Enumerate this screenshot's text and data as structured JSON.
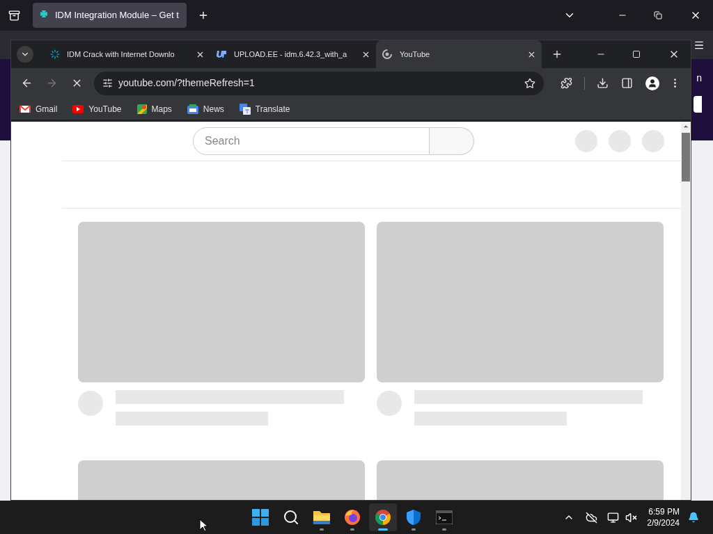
{
  "back_browser": {
    "tabs": [
      {
        "title": "IDM Integration Module – Get t",
        "selected": true
      }
    ],
    "page_fragment": "n"
  },
  "browser": {
    "tabs": [
      {
        "title": "IDM Crack with Internet Downlo",
        "selected": false,
        "kind": "spinner"
      },
      {
        "title": "UPLOAD.EE - idm.6.42.3_with_a",
        "selected": false,
        "kind": "up"
      },
      {
        "title": "YouTube",
        "selected": true,
        "kind": "loading"
      }
    ],
    "address": "youtube.com/?themeRefresh=1",
    "bookmarks": [
      {
        "label": "Gmail",
        "kind": "gmail"
      },
      {
        "label": "YouTube",
        "kind": "youtube"
      },
      {
        "label": "Maps",
        "kind": "maps"
      },
      {
        "label": "News",
        "kind": "news"
      },
      {
        "label": "Translate",
        "kind": "translate"
      }
    ],
    "page": {
      "search_placeholder": "Search"
    }
  },
  "taskbar": {
    "apps": [
      {
        "kind": "start",
        "open": false,
        "selected": false
      },
      {
        "kind": "search",
        "open": false,
        "selected": false
      },
      {
        "kind": "folder",
        "open": true,
        "selected": false
      },
      {
        "kind": "firefox",
        "open": true,
        "selected": false
      },
      {
        "kind": "chrome",
        "open": true,
        "selected": true
      },
      {
        "kind": "shield",
        "open": true,
        "selected": false
      },
      {
        "kind": "terminal",
        "open": true,
        "selected": false
      }
    ],
    "time": "6:59 PM",
    "date": "2/9/2024"
  }
}
